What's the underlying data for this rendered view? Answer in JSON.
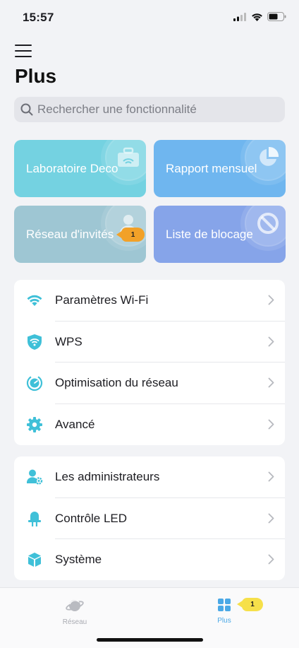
{
  "status_bar": {
    "time": "15:57"
  },
  "page": {
    "title": "Plus"
  },
  "search": {
    "placeholder": "Rechercher une fonctionnalité"
  },
  "tiles": [
    {
      "label": "Laboratoire Deco",
      "icon": "briefcase-wifi-icon",
      "color": "#74d2e1"
    },
    {
      "label": "Rapport mensuel",
      "icon": "pie-chart-icon",
      "color": "#6fb6ef"
    },
    {
      "label": "Réseau d'invités",
      "icon": "guest-user-icon",
      "color": "#9ec6d3",
      "badge": "1"
    },
    {
      "label": "Liste de blocage",
      "icon": "block-icon",
      "color": "#86a4e9"
    }
  ],
  "settings_group_1": [
    {
      "label": "Paramètres Wi-Fi",
      "icon": "wifi-icon"
    },
    {
      "label": "WPS",
      "icon": "wps-shield-icon"
    },
    {
      "label": "Optimisation du réseau",
      "icon": "network-optimization-icon"
    },
    {
      "label": "Avancé",
      "icon": "gear-icon"
    }
  ],
  "settings_group_2": [
    {
      "label": "Les administrateurs",
      "icon": "admin-user-icon"
    },
    {
      "label": "Contrôle LED",
      "icon": "led-icon"
    },
    {
      "label": "Système",
      "icon": "system-cube-icon"
    }
  ],
  "tabbar": {
    "tabs": [
      {
        "label": "Réseau",
        "icon": "planet-icon",
        "active": false
      },
      {
        "label": "Plus",
        "icon": "grid-icon",
        "active": true,
        "badge": "1"
      }
    ]
  },
  "colors": {
    "accent": "#4aa8e6",
    "icon_teal": "#3fc0d8",
    "orange_badge": "#f2a128",
    "yellow_badge": "#f6e04a"
  }
}
